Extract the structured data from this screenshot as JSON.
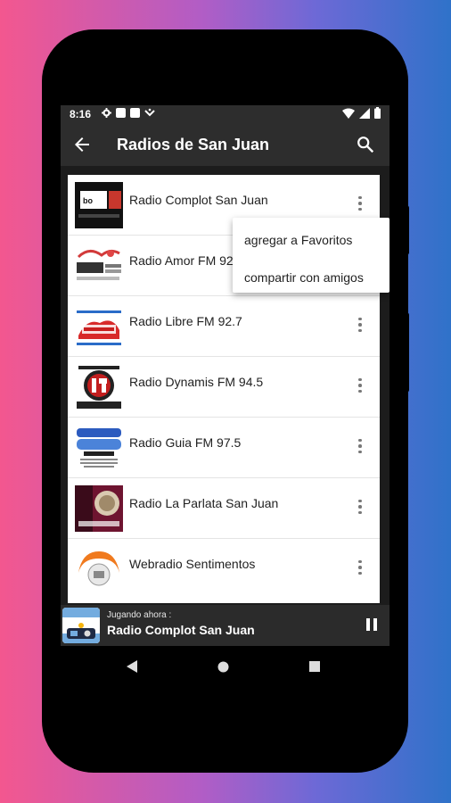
{
  "status_bar": {
    "time": "8:16"
  },
  "app_bar": {
    "title": "Radios de San Juan"
  },
  "stations": [
    {
      "name": "Radio Complot San Juan"
    },
    {
      "name": "Radio Amor FM 92"
    },
    {
      "name": "Radio Libre FM 92.7"
    },
    {
      "name": "Radio Dynamis FM 94.5"
    },
    {
      "name": "Radio Guia FM 97.5"
    },
    {
      "name": "Radio La Parlata San Juan"
    },
    {
      "name": "Webradio Sentimentos"
    }
  ],
  "context_menu": {
    "items": [
      "agregar a Favoritos",
      "compartir con amigos"
    ]
  },
  "player": {
    "subtitle": "Jugando ahora :",
    "title": "Radio Complot San Juan"
  },
  "colors": {
    "bar": "#2d2d2d",
    "player": "#2b2b2b",
    "list_bg": "#ffffff"
  }
}
